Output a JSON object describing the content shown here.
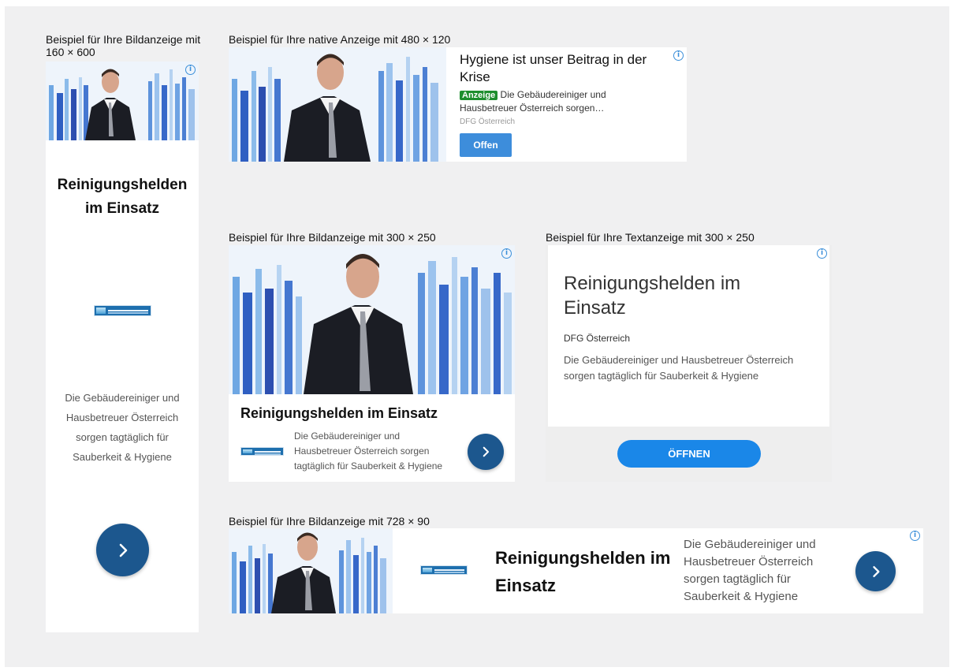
{
  "ads": {
    "skyscraper": {
      "caption": "Beispiel für Ihre Bildanzeige mit 160 × 600",
      "headline": "Reinigungshelden im Einsatz",
      "description": "Die Gebäudereiniger und Hausbetreuer Österreich sorgen tagtäglich für Sauberkeit & Hygiene"
    },
    "native": {
      "caption": "Beispiel für Ihre native Anzeige mit 480 × 120",
      "headline": "Hygiene ist unser Beitrag in der Krise",
      "badge": "Anzeige",
      "description": "Die Gebäudereiniger und Hausbetreuer Österreich sorgen…",
      "advertiser": "DFG Österreich",
      "button_label": "Offen"
    },
    "medium_rectangle": {
      "caption": "Beispiel für Ihre Bildanzeige mit 300 × 250",
      "headline": "Reinigungshelden im Einsatz",
      "description": "Die Gebäudereiniger und Hausbetreuer Österreich sorgen tagtäglich für Sauberkeit & Hygiene"
    },
    "text_ad": {
      "caption": "Beispiel für Ihre Textanzeige mit 300 × 250",
      "headline": "Reinigungshelden im Einsatz",
      "advertiser": "DFG Österreich",
      "description": "Die Gebäudereiniger und Hausbetreuer Österreich sorgen tagtäglich für Sauberkeit & Hygiene",
      "button_label": "ÖFFNEN"
    },
    "leaderboard": {
      "caption": "Beispiel für Ihre Bildanzeige mit 728 × 90",
      "headline": "Reinigungshelden im Einsatz",
      "description": "Die Gebäudereiniger und Hausbetreuer Österreich sorgen tagtäglich für Sauberkeit & Hygiene"
    }
  },
  "icons": {
    "info": "info-icon",
    "arrow": "chevron-right-icon"
  },
  "colors": {
    "background": "#f0f0f1",
    "arrow_button": "#1c578e",
    "open_button": "#1a87e8",
    "native_button": "#3d8ddb",
    "badge": "#1e8e2e",
    "info_icon": "#3b8fd9"
  }
}
